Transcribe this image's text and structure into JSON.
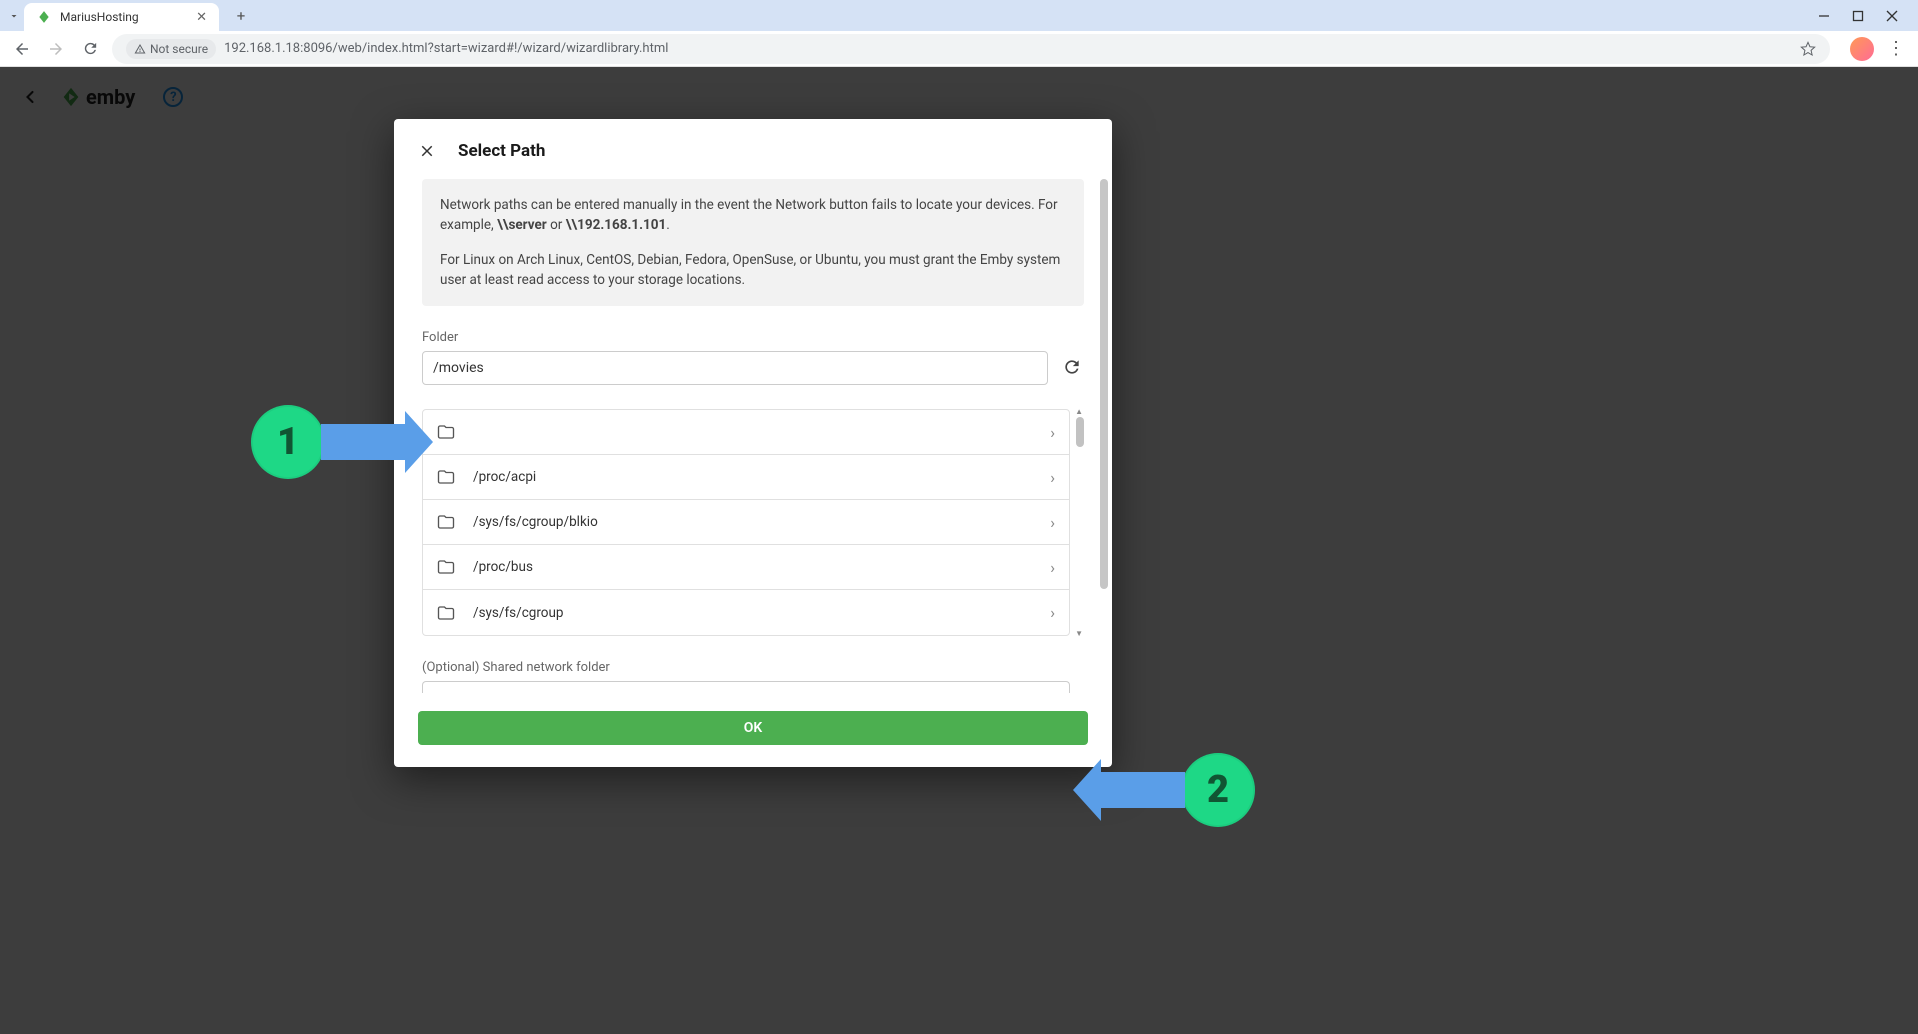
{
  "browser": {
    "tab_title": "MariusHosting",
    "url": "192.168.1.18:8096/web/index.html?start=wizard#!/wizard/wizardlibrary.html",
    "not_secure": "Not secure"
  },
  "emby": {
    "brand": "emby"
  },
  "dialog": {
    "title": "Select Path",
    "info_text_prefix": "Network paths can be entered manually in the event the Network button fails to locate your devices. For example, ",
    "info_example1": "\\\\server",
    "info_or": " or ",
    "info_example2": "\\\\192.168.1.101",
    "info_dot": ".",
    "linux_text": "For Linux on Arch Linux, CentOS, Debian, Fedora, OpenSuse, or Ubuntu, you must grant the Emby system user at least read access to your storage locations.",
    "folder_label": "Folder",
    "folder_value": "/movies",
    "folders": [
      {
        "path": ""
      },
      {
        "path": "/proc/acpi"
      },
      {
        "path": "/sys/fs/cgroup/blkio"
      },
      {
        "path": "/proc/bus"
      },
      {
        "path": "/sys/fs/cgroup"
      }
    ],
    "optional_label": "(Optional) Shared network folder",
    "ok_label": "OK"
  },
  "annotations": {
    "one": "1",
    "two": "2"
  }
}
